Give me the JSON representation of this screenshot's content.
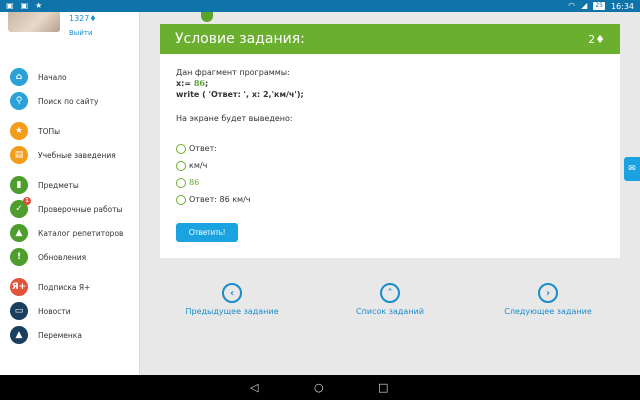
{
  "status_bar": {
    "left_icons": [
      "image-icon",
      "image-icon",
      "star-icon"
    ],
    "battery": "25",
    "time": "16:34"
  },
  "sidebar": {
    "score": "1327♦",
    "logout_label": "Выйти",
    "items": [
      {
        "label": "Начало",
        "icon": "home-icon",
        "color": "#2ba0d9",
        "glyph": "⌂"
      },
      {
        "label": "Поиск по сайту",
        "icon": "search-icon",
        "color": "#2ba0d9",
        "glyph": "⚲"
      },
      {
        "label": "ТОПы",
        "icon": "star-icon",
        "color": "#f39c1a",
        "glyph": "★"
      },
      {
        "label": "Учебные заведения",
        "icon": "building-icon",
        "color": "#f39c1a",
        "glyph": "▤"
      },
      {
        "label": "Предметы",
        "icon": "book-icon",
        "color": "#4e9e2e",
        "glyph": "▮"
      },
      {
        "label": "Проверочные работы",
        "icon": "check-icon",
        "color": "#4e9e2e",
        "glyph": "✓",
        "badge": "1"
      },
      {
        "label": "Каталог репетиторов",
        "icon": "graduation-cap-icon",
        "color": "#4e9e2e",
        "glyph": "▲"
      },
      {
        "label": "Обновления",
        "icon": "exclamation-icon",
        "color": "#4e9e2e",
        "glyph": "!"
      },
      {
        "label": "Подписка Я+",
        "icon": "ya-plus-icon",
        "color": "#e2533b",
        "glyph": "Я+"
      },
      {
        "label": "Новости",
        "icon": "chat-icon",
        "color": "#1a3f5e",
        "glyph": "▭"
      },
      {
        "label": "Переменка",
        "icon": "bell-icon",
        "color": "#1a3f5e",
        "glyph": "▲"
      }
    ]
  },
  "task": {
    "title": "Условие задания:",
    "points": "2♦",
    "intro": "Дан фрагмент программы:",
    "code_line1_prefix": "x:= ",
    "code_line1_value": "86",
    "code_line1_suffix": ";",
    "code_line2": "write ( 'Ответ: ', x: 2,'км/ч');",
    "question": "На экране будет выведено:",
    "options": [
      {
        "text": "Ответ:",
        "green": false
      },
      {
        "text": "км/ч",
        "green": false
      },
      {
        "text": "86",
        "green": true
      },
      {
        "text": "Ответ: 86 км/ч",
        "green": false
      }
    ],
    "answer_button": "Ответить!"
  },
  "navigation": {
    "prev_label": "Предыдущее задание",
    "list_label": "Список заданий",
    "next_label": "Следующее задание"
  }
}
